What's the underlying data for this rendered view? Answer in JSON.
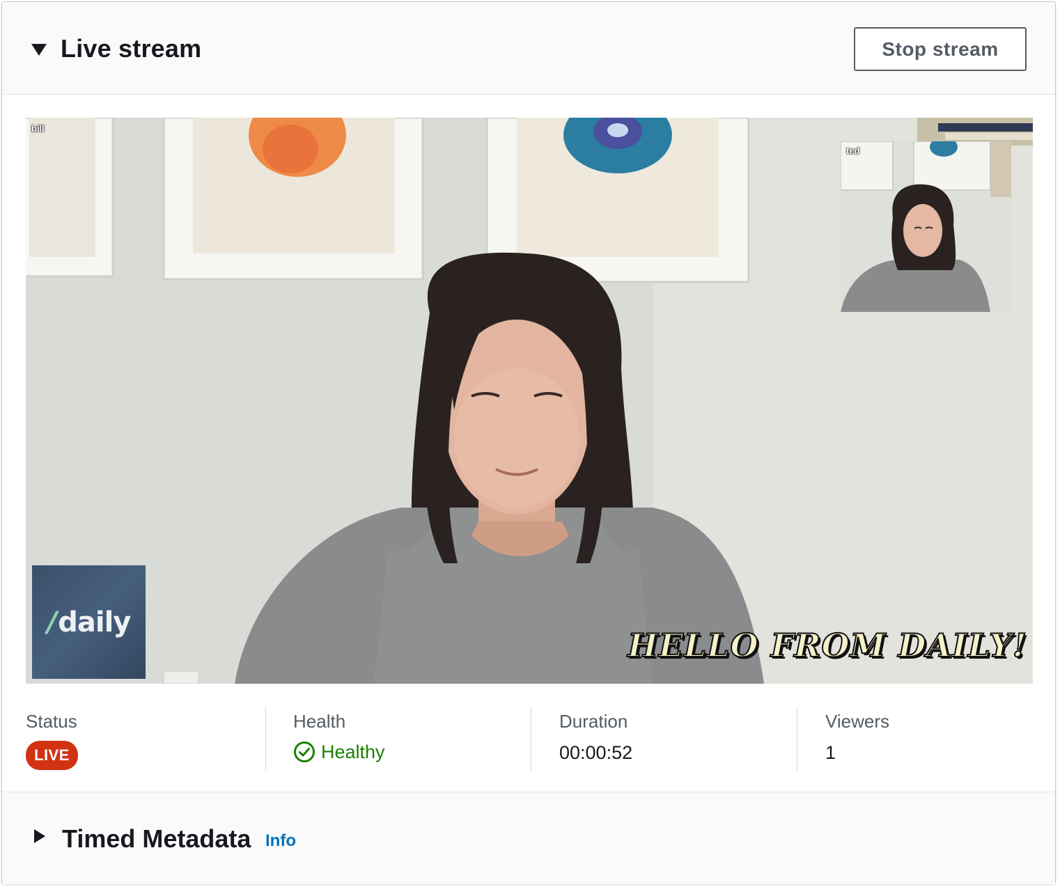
{
  "header": {
    "title": "Live stream",
    "stop_button_label": "Stop stream",
    "collapse_icon": "caret-down-icon"
  },
  "video": {
    "main_participant_name": "bill",
    "pip_participant_name": "ted",
    "logo_text": "/daily",
    "overlay_text": "Hello from Daily!"
  },
  "stats": {
    "status": {
      "label": "Status",
      "value": "LIVE",
      "color": "#d13212"
    },
    "health": {
      "label": "Health",
      "value": "Healthy",
      "icon": "check-circle-icon",
      "color": "#1d8102"
    },
    "duration": {
      "label": "Duration",
      "value": "00:00:52"
    },
    "viewers": {
      "label": "Viewers",
      "value": "1"
    }
  },
  "footer": {
    "title": "Timed Metadata",
    "info_link": "Info",
    "expand_icon": "caret-right-icon",
    "link_color": "#0073bb"
  }
}
